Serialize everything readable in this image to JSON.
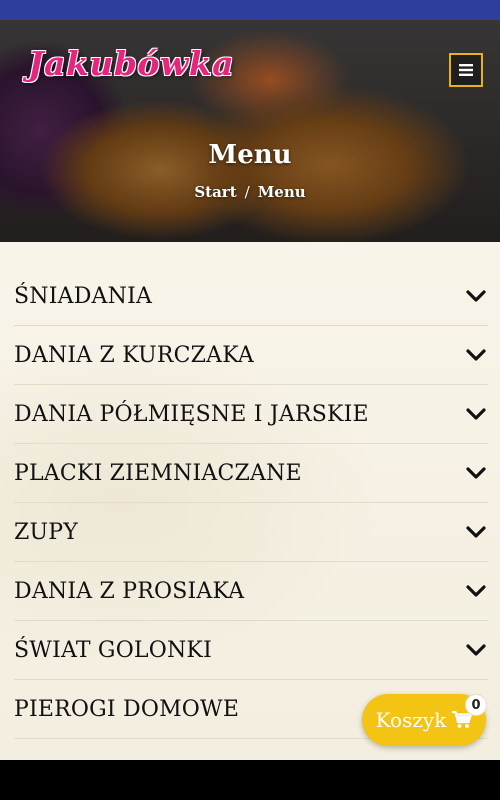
{
  "header": {
    "logo_text": "Jakubówka",
    "menu_icon": "hamburger-icon",
    "title": "Menu",
    "breadcrumb": {
      "home": "Start",
      "separator": "/",
      "current": "Menu"
    }
  },
  "categories": [
    {
      "label": "ŚNIADANIA"
    },
    {
      "label": "DANIA Z KURCZAKA"
    },
    {
      "label": "DANIA PÓŁMIĘSNE I JARSKIE"
    },
    {
      "label": "PLACKI ZIEMNIACZANE"
    },
    {
      "label": "ZUPY"
    },
    {
      "label": "DANIA Z PROSIAKA"
    },
    {
      "label": "ŚWIAT GOLONKI"
    },
    {
      "label": "PIEROGI DOMOWE"
    }
  ],
  "cart": {
    "label": "Koszyk",
    "icon": "shopping-cart-icon",
    "count": "0"
  },
  "colors": {
    "topbar": "#2e3e9c",
    "logo": "#e6267e",
    "accent": "#f4c414",
    "menu_border": "#e5b21c"
  }
}
